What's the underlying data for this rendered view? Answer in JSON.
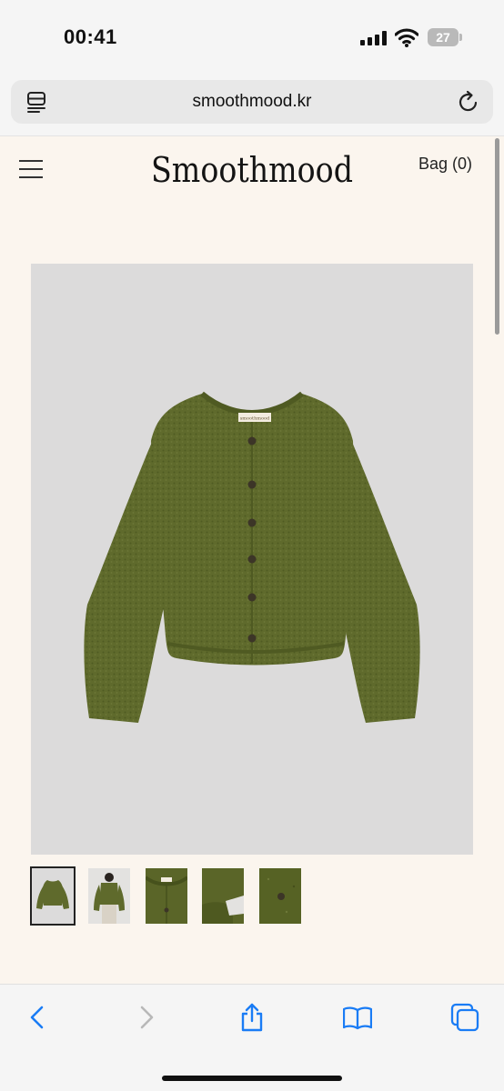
{
  "status_bar": {
    "time": "00:41",
    "battery_level": "27",
    "signal_icon": "cellular-signal-icon",
    "wifi_icon": "wifi-icon"
  },
  "browser": {
    "url": "smoothmood.kr",
    "reader_icon": "reader-mode-icon",
    "reload_icon": "reload-icon",
    "toolbar_icons": [
      "back-arrow-icon",
      "forward-arrow-icon",
      "share-icon",
      "bookmarks-icon",
      "tabs-icon"
    ]
  },
  "site": {
    "logo_text": "Smoothmood",
    "bag_label": "Bag (0)",
    "menu_icon": "hamburger-menu-icon"
  },
  "product": {
    "main_image": "olive-green-cardigan",
    "garment_color": "#5f6a2c",
    "label_text": "smoothmood",
    "thumbnails": [
      "cardigan-front",
      "cardigan-worn",
      "cardigan-neck-detail",
      "cardigan-cuff-detail",
      "cardigan-button-detail"
    ],
    "selected_thumbnail": 0
  },
  "colors": {
    "page_background": "#fbf5ee",
    "accent_blue": "#1a7cf5"
  }
}
